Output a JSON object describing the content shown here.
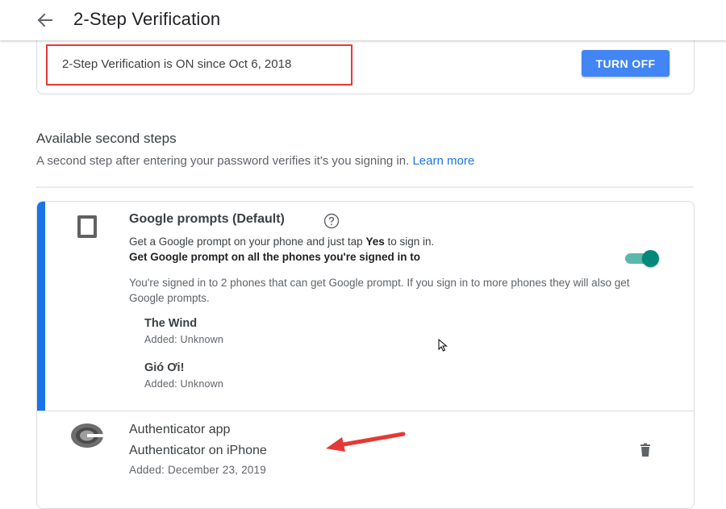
{
  "header": {
    "title": "2-Step Verification",
    "back_icon": "arrow-back-icon"
  },
  "status": {
    "text": "2-Step Verification is ON since Oct 6, 2018",
    "turn_off_label": "TURN OFF",
    "button_color": "#4285f4",
    "highlight_color": "#e53935"
  },
  "second_steps": {
    "title": "Available second steps",
    "description": "A second step after entering your password verifies it's you signing in.",
    "learn_more": "Learn more"
  },
  "google_prompts": {
    "icon": "phone-icon",
    "title": "Google prompts (Default)",
    "help_icon": "help-circle-icon",
    "desc_prefix": "Get a Google prompt on your phone and just tap ",
    "desc_bold": "Yes",
    "desc_suffix": " to sign in.",
    "all_phones_label": "Get Google prompt on all the phones you're signed in to",
    "all_phones_enabled": true,
    "signed_in_text": "You're signed in to 2 phones that can get Google prompt. If you sign in to more phones they will also get Google prompts.",
    "devices": [
      {
        "name": "The Wind",
        "added": "Added: Unknown"
      },
      {
        "name": "Gió Ơi!",
        "added": "Added: Unknown"
      }
    ],
    "accent_color": "#1a73e8"
  },
  "authenticator": {
    "icon": "authenticator-icon",
    "title": "Authenticator app",
    "device": "Authenticator on iPhone",
    "added": "Added: December 23, 2019",
    "delete_icon": "trash-icon"
  }
}
